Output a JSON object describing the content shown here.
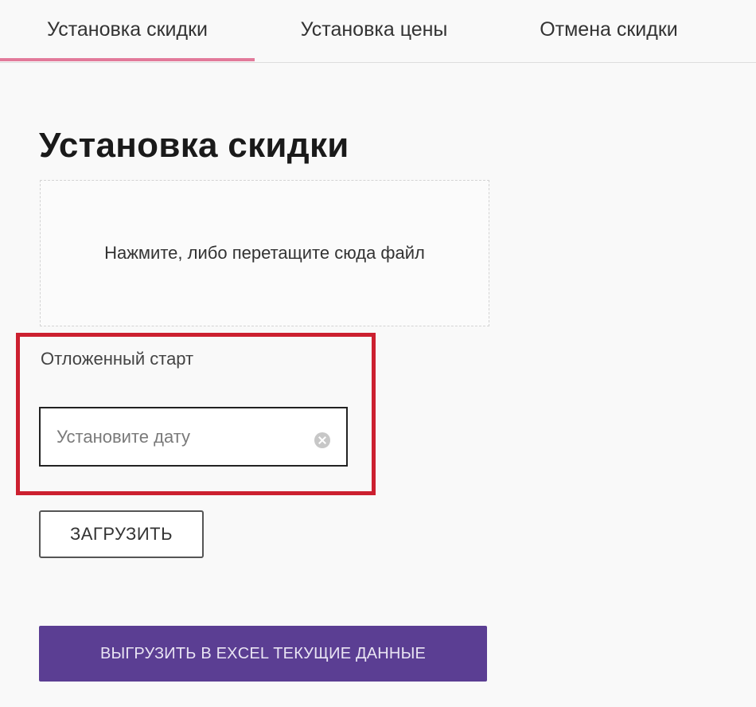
{
  "tabs": [
    {
      "label": "Установка скидки",
      "active": true
    },
    {
      "label": "Установка цены",
      "active": false
    },
    {
      "label": "Отмена скидки",
      "active": false
    }
  ],
  "main": {
    "title": "Установка скидки",
    "dropzone_text": "Нажмите, либо перетащите сюда файл",
    "delayed_start": {
      "label": "Отложенный старт",
      "date_placeholder": "Установите дату",
      "date_value": ""
    },
    "upload_button_label": "ЗАГРУЗИТЬ",
    "export_button_label": "ВЫГРУЗИТЬ В EXCEL ТЕКУЩИЕ ДАННЫЕ"
  },
  "icons": {
    "clear": "clear-icon"
  },
  "colors": {
    "active_tab_underline": "#e27a9a",
    "highlight_frame": "#cc2030",
    "export_button_bg": "#5b3e93"
  }
}
